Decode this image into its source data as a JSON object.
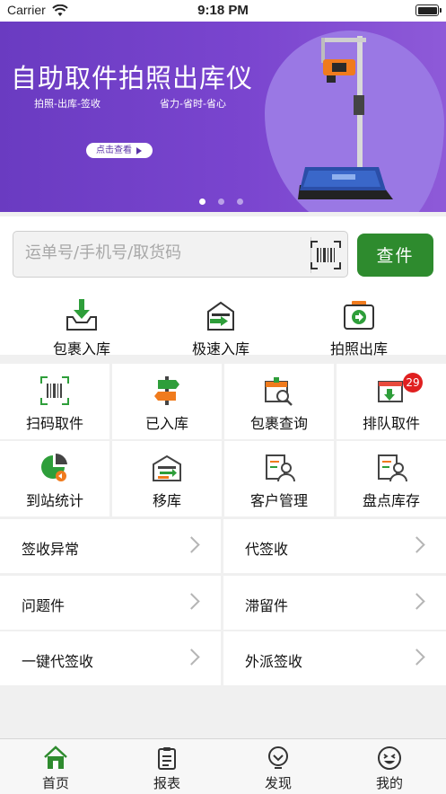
{
  "status_bar": {
    "carrier": "Carrier",
    "time": "9:18 PM"
  },
  "banner": {
    "title": "自助取件拍照出库仪",
    "subtitle_left": "拍照-出库-签收",
    "subtitle_right": "省力-省时-省心",
    "button_label": "点击查看",
    "page_count": 3,
    "active_page": 1
  },
  "search": {
    "placeholder": "运单号/手机号/取货码",
    "button_label": "查件"
  },
  "quick_actions": [
    {
      "label": "包裹入库",
      "icon": "inbound-tray-icon"
    },
    {
      "label": "极速入库",
      "icon": "fast-warehouse-icon"
    },
    {
      "label": "拍照出库",
      "icon": "camera-outbound-icon"
    }
  ],
  "grid_row1": [
    {
      "label": "扫码取件",
      "icon": "barcode-scan-icon"
    },
    {
      "label": "已入库",
      "icon": "signpost-icon"
    },
    {
      "label": "包裹查询",
      "icon": "package-search-icon"
    },
    {
      "label": "排队取件",
      "icon": "queue-calendar-icon",
      "badge": "29"
    }
  ],
  "grid_row2": [
    {
      "label": "到站统计",
      "icon": "pie-chart-icon"
    },
    {
      "label": "移库",
      "icon": "move-warehouse-icon"
    },
    {
      "label": "客户管理",
      "icon": "customer-icon"
    },
    {
      "label": "盘点库存",
      "icon": "inventory-icon"
    }
  ],
  "menu_rows": [
    {
      "left": "签收异常",
      "right": "代签收"
    },
    {
      "left": "问题件",
      "right": "滞留件"
    },
    {
      "left": "一键代签收",
      "right": "外派签收"
    }
  ],
  "tab_bar": [
    {
      "label": "首页",
      "icon": "home-icon",
      "active": true
    },
    {
      "label": "报表",
      "icon": "report-icon"
    },
    {
      "label": "发现",
      "icon": "discover-icon"
    },
    {
      "label": "我的",
      "icon": "profile-icon"
    }
  ],
  "colors": {
    "brand_green": "#2e8b2e",
    "banner_purple": "#6a3bc1",
    "badge_red": "#e02020"
  }
}
